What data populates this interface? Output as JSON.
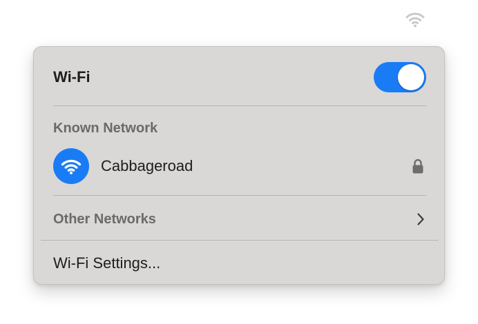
{
  "menubar": {
    "wifi_icon": "wifi-icon"
  },
  "panel": {
    "title": "Wi-Fi",
    "toggle": {
      "state": "on",
      "color": "#1a7cf5"
    },
    "known_section": {
      "label": "Known Network",
      "networks": [
        {
          "name": "Cabbageroad",
          "icon": "wifi-icon",
          "secured": true,
          "security_icon": "lock-icon"
        }
      ]
    },
    "other_networks": {
      "label": "Other Networks",
      "icon": "chevron-right-icon"
    },
    "settings": {
      "label": "Wi-Fi Settings..."
    }
  },
  "colors": {
    "accent": "#1a7cf5",
    "panel_background": "#d9d8d7",
    "secondary_text": "#6b6a69",
    "primary_text": "#1d1d1d"
  }
}
